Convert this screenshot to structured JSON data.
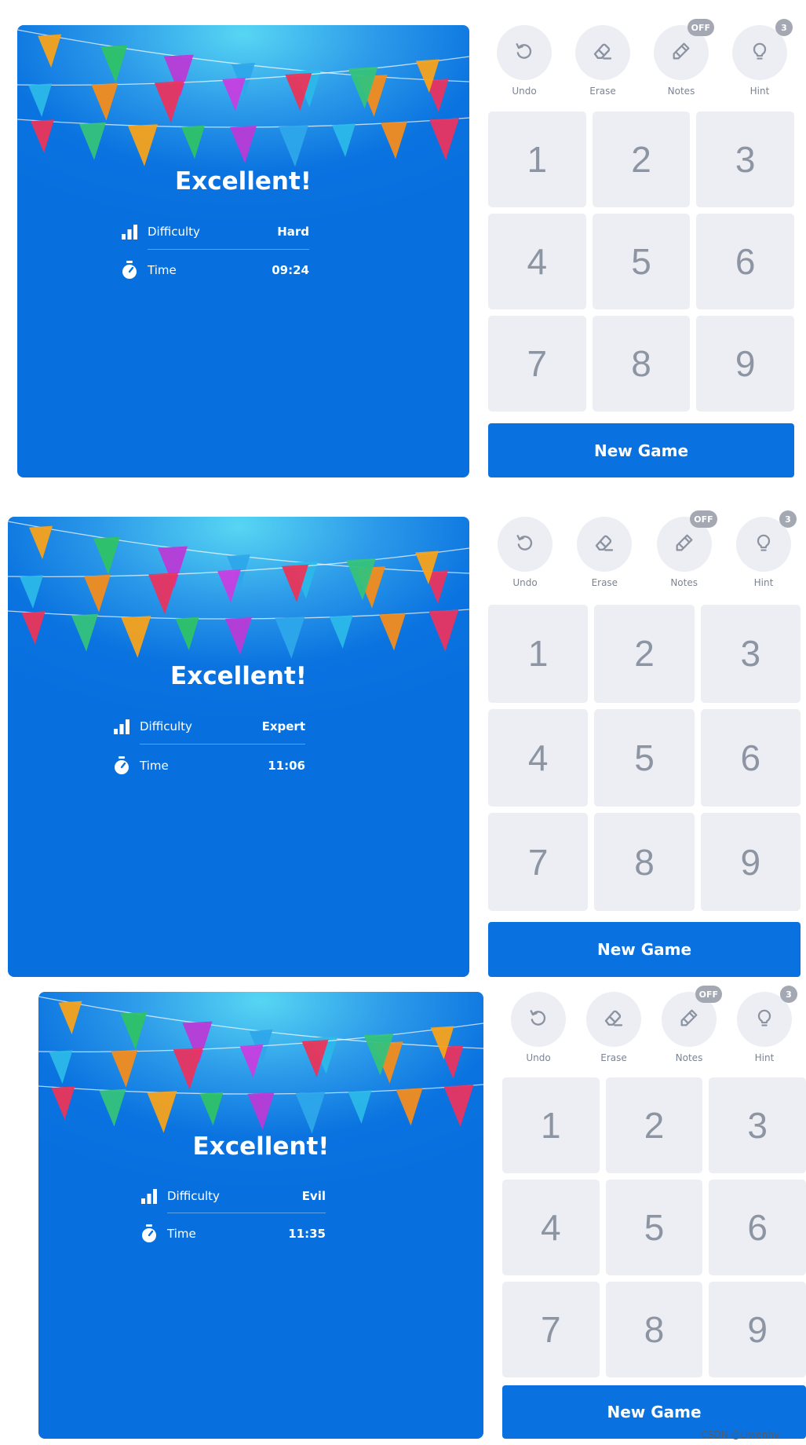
{
  "colors": {
    "primary_blue": "#0a72e0",
    "key_background": "#eceef3",
    "key_text": "#8d95a3",
    "badge": "#a3a8b3"
  },
  "screens": [
    {
      "title": "Excellent!",
      "difficulty_label": "Difficulty",
      "difficulty_value": "Hard",
      "time_label": "Time",
      "time_value": "09:24",
      "tools": [
        {
          "label": "Undo",
          "icon": "undo-icon"
        },
        {
          "label": "Erase",
          "icon": "eraser-icon"
        },
        {
          "label": "Notes",
          "icon": "pencil-icon",
          "badge": "OFF"
        },
        {
          "label": "Hint",
          "icon": "lightbulb-icon",
          "badge": "3"
        }
      ],
      "keys": [
        "1",
        "2",
        "3",
        "4",
        "5",
        "6",
        "7",
        "8",
        "9"
      ],
      "new_game_label": "New Game"
    },
    {
      "title": "Excellent!",
      "difficulty_label": "Difficulty",
      "difficulty_value": "Expert",
      "time_label": "Time",
      "time_value": "11:06",
      "tools": [
        {
          "label": "Undo",
          "icon": "undo-icon"
        },
        {
          "label": "Erase",
          "icon": "eraser-icon"
        },
        {
          "label": "Notes",
          "icon": "pencil-icon",
          "badge": "OFF"
        },
        {
          "label": "Hint",
          "icon": "lightbulb-icon",
          "badge": "3"
        }
      ],
      "keys": [
        "1",
        "2",
        "3",
        "4",
        "5",
        "6",
        "7",
        "8",
        "9"
      ],
      "new_game_label": "New Game"
    },
    {
      "title": "Excellent!",
      "difficulty_label": "Difficulty",
      "difficulty_value": "Evil",
      "time_label": "Time",
      "time_value": "11:35",
      "tools": [
        {
          "label": "Undo",
          "icon": "undo-icon"
        },
        {
          "label": "Erase",
          "icon": "eraser-icon"
        },
        {
          "label": "Notes",
          "icon": "pencil-icon",
          "badge": "OFF"
        },
        {
          "label": "Hint",
          "icon": "lightbulb-icon",
          "badge": "3"
        }
      ],
      "keys": [
        "1",
        "2",
        "3",
        "4",
        "5",
        "6",
        "7",
        "8",
        "9"
      ],
      "new_game_label": "New Game"
    }
  ],
  "watermark": "CSDN @Liwenhv"
}
